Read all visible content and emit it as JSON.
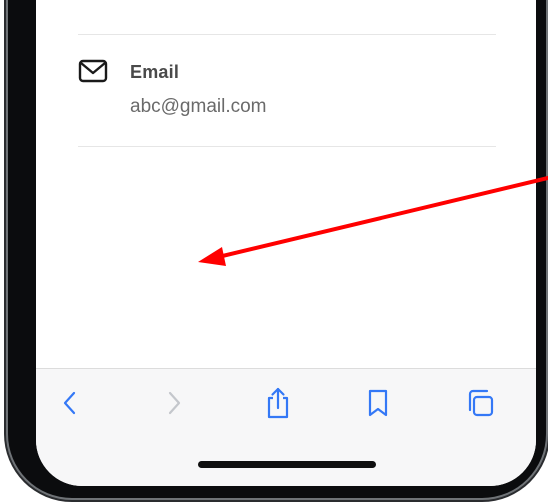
{
  "contact": {
    "email_label": "Email",
    "email_value": "abc@gmail.com"
  },
  "toolbar": {
    "items": [
      {
        "name": "back",
        "icon": "chevron-left-icon",
        "enabled": true
      },
      {
        "name": "forward",
        "icon": "chevron-right-icon",
        "enabled": false
      },
      {
        "name": "share",
        "icon": "share-icon",
        "enabled": true
      },
      {
        "name": "bookmarks",
        "icon": "bookmark-icon",
        "enabled": true
      },
      {
        "name": "tabs",
        "icon": "tabs-icon",
        "enabled": true
      }
    ]
  },
  "colors": {
    "accent": "#3478f6",
    "disabled": "#c4c7cc",
    "annotation_arrow": "#ff0000"
  }
}
